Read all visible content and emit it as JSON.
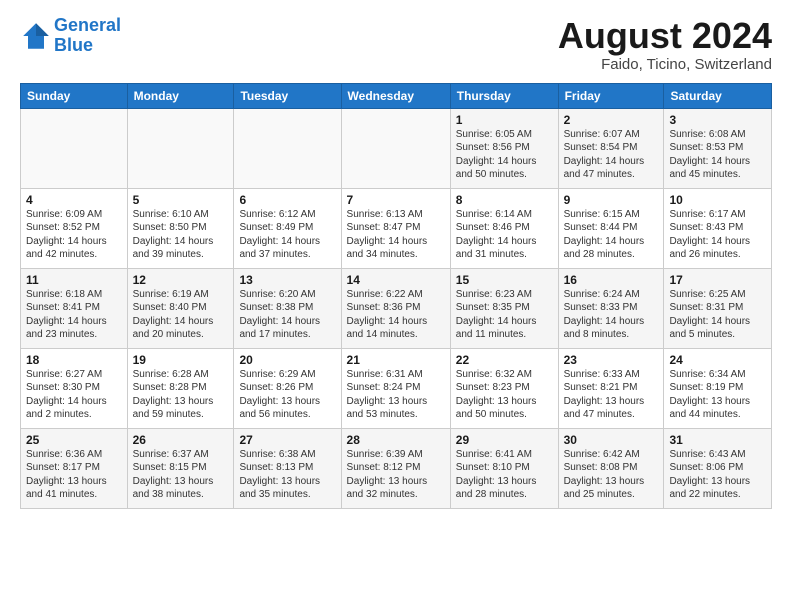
{
  "header": {
    "logo_line1": "General",
    "logo_line2": "Blue",
    "title": "August 2024",
    "subtitle": "Faido, Ticino, Switzerland"
  },
  "days_of_week": [
    "Sunday",
    "Monday",
    "Tuesday",
    "Wednesday",
    "Thursday",
    "Friday",
    "Saturday"
  ],
  "weeks": [
    [
      {
        "day": "",
        "info": ""
      },
      {
        "day": "",
        "info": ""
      },
      {
        "day": "",
        "info": ""
      },
      {
        "day": "",
        "info": ""
      },
      {
        "day": "1",
        "info": "Sunrise: 6:05 AM\nSunset: 8:56 PM\nDaylight: 14 hours\nand 50 minutes."
      },
      {
        "day": "2",
        "info": "Sunrise: 6:07 AM\nSunset: 8:54 PM\nDaylight: 14 hours\nand 47 minutes."
      },
      {
        "day": "3",
        "info": "Sunrise: 6:08 AM\nSunset: 8:53 PM\nDaylight: 14 hours\nand 45 minutes."
      }
    ],
    [
      {
        "day": "4",
        "info": "Sunrise: 6:09 AM\nSunset: 8:52 PM\nDaylight: 14 hours\nand 42 minutes."
      },
      {
        "day": "5",
        "info": "Sunrise: 6:10 AM\nSunset: 8:50 PM\nDaylight: 14 hours\nand 39 minutes."
      },
      {
        "day": "6",
        "info": "Sunrise: 6:12 AM\nSunset: 8:49 PM\nDaylight: 14 hours\nand 37 minutes."
      },
      {
        "day": "7",
        "info": "Sunrise: 6:13 AM\nSunset: 8:47 PM\nDaylight: 14 hours\nand 34 minutes."
      },
      {
        "day": "8",
        "info": "Sunrise: 6:14 AM\nSunset: 8:46 PM\nDaylight: 14 hours\nand 31 minutes."
      },
      {
        "day": "9",
        "info": "Sunrise: 6:15 AM\nSunset: 8:44 PM\nDaylight: 14 hours\nand 28 minutes."
      },
      {
        "day": "10",
        "info": "Sunrise: 6:17 AM\nSunset: 8:43 PM\nDaylight: 14 hours\nand 26 minutes."
      }
    ],
    [
      {
        "day": "11",
        "info": "Sunrise: 6:18 AM\nSunset: 8:41 PM\nDaylight: 14 hours\nand 23 minutes."
      },
      {
        "day": "12",
        "info": "Sunrise: 6:19 AM\nSunset: 8:40 PM\nDaylight: 14 hours\nand 20 minutes."
      },
      {
        "day": "13",
        "info": "Sunrise: 6:20 AM\nSunset: 8:38 PM\nDaylight: 14 hours\nand 17 minutes."
      },
      {
        "day": "14",
        "info": "Sunrise: 6:22 AM\nSunset: 8:36 PM\nDaylight: 14 hours\nand 14 minutes."
      },
      {
        "day": "15",
        "info": "Sunrise: 6:23 AM\nSunset: 8:35 PM\nDaylight: 14 hours\nand 11 minutes."
      },
      {
        "day": "16",
        "info": "Sunrise: 6:24 AM\nSunset: 8:33 PM\nDaylight: 14 hours\nand 8 minutes."
      },
      {
        "day": "17",
        "info": "Sunrise: 6:25 AM\nSunset: 8:31 PM\nDaylight: 14 hours\nand 5 minutes."
      }
    ],
    [
      {
        "day": "18",
        "info": "Sunrise: 6:27 AM\nSunset: 8:30 PM\nDaylight: 14 hours\nand 2 minutes."
      },
      {
        "day": "19",
        "info": "Sunrise: 6:28 AM\nSunset: 8:28 PM\nDaylight: 13 hours\nand 59 minutes."
      },
      {
        "day": "20",
        "info": "Sunrise: 6:29 AM\nSunset: 8:26 PM\nDaylight: 13 hours\nand 56 minutes."
      },
      {
        "day": "21",
        "info": "Sunrise: 6:31 AM\nSunset: 8:24 PM\nDaylight: 13 hours\nand 53 minutes."
      },
      {
        "day": "22",
        "info": "Sunrise: 6:32 AM\nSunset: 8:23 PM\nDaylight: 13 hours\nand 50 minutes."
      },
      {
        "day": "23",
        "info": "Sunrise: 6:33 AM\nSunset: 8:21 PM\nDaylight: 13 hours\nand 47 minutes."
      },
      {
        "day": "24",
        "info": "Sunrise: 6:34 AM\nSunset: 8:19 PM\nDaylight: 13 hours\nand 44 minutes."
      }
    ],
    [
      {
        "day": "25",
        "info": "Sunrise: 6:36 AM\nSunset: 8:17 PM\nDaylight: 13 hours\nand 41 minutes."
      },
      {
        "day": "26",
        "info": "Sunrise: 6:37 AM\nSunset: 8:15 PM\nDaylight: 13 hours\nand 38 minutes."
      },
      {
        "day": "27",
        "info": "Sunrise: 6:38 AM\nSunset: 8:13 PM\nDaylight: 13 hours\nand 35 minutes."
      },
      {
        "day": "28",
        "info": "Sunrise: 6:39 AM\nSunset: 8:12 PM\nDaylight: 13 hours\nand 32 minutes."
      },
      {
        "day": "29",
        "info": "Sunrise: 6:41 AM\nSunset: 8:10 PM\nDaylight: 13 hours\nand 28 minutes."
      },
      {
        "day": "30",
        "info": "Sunrise: 6:42 AM\nSunset: 8:08 PM\nDaylight: 13 hours\nand 25 minutes."
      },
      {
        "day": "31",
        "info": "Sunrise: 6:43 AM\nSunset: 8:06 PM\nDaylight: 13 hours\nand 22 minutes."
      }
    ]
  ]
}
